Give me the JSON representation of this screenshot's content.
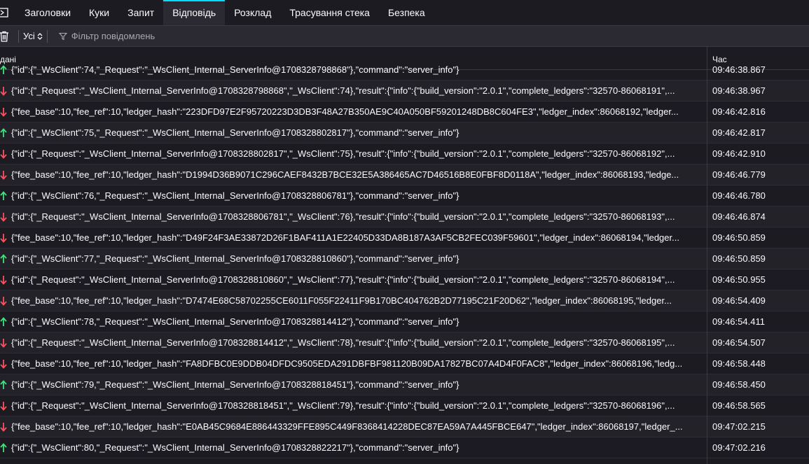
{
  "tabs": [
    {
      "label": "Заголовки",
      "selected": false
    },
    {
      "label": "Куки",
      "selected": false
    },
    {
      "label": "Запит",
      "selected": false
    },
    {
      "label": "Відповідь",
      "selected": true
    },
    {
      "label": "Розклад",
      "selected": false
    },
    {
      "label": "Трасування стека",
      "selected": false
    },
    {
      "label": "Безпека",
      "selected": false
    }
  ],
  "toolbar": {
    "select_value": "Усі",
    "filter_placeholder": "Фільтр повідомлень"
  },
  "columns": {
    "data": "дані",
    "time": "Час"
  },
  "colors": {
    "sent": "#3fe17a",
    "received": "#ff4f5e",
    "accent": "#00ddff"
  },
  "messages": [
    {
      "direction": "sent",
      "text": "{\"id\":{\"_WsClient\":74,\"_Request\":\"_WsClient_Internal_ServerInfo@1708328798868\"},\"command\":\"server_info\"}",
      "time": "09:46:38.867"
    },
    {
      "direction": "received",
      "text": "{\"id\":{\"_Request\":\"_WsClient_Internal_ServerInfo@1708328798868\",\"_WsClient\":74},\"result\":{\"info\":{\"build_version\":\"2.0.1\",\"complete_ledgers\":\"32570-86068191\",...",
      "time": "09:46:38.967"
    },
    {
      "direction": "received",
      "text": "{\"fee_base\":10,\"fee_ref\":10,\"ledger_hash\":\"223DFD97E2F95720223D3DB3F48A27B350AE9C40A050BF59201248DB8C604FE3\",\"ledger_index\":86068192,\"ledger...",
      "time": "09:46:42.816"
    },
    {
      "direction": "sent",
      "text": "{\"id\":{\"_WsClient\":75,\"_Request\":\"_WsClient_Internal_ServerInfo@1708328802817\"},\"command\":\"server_info\"}",
      "time": "09:46:42.817"
    },
    {
      "direction": "received",
      "text": "{\"id\":{\"_Request\":\"_WsClient_Internal_ServerInfo@1708328802817\",\"_WsClient\":75},\"result\":{\"info\":{\"build_version\":\"2.0.1\",\"complete_ledgers\":\"32570-86068192\",...",
      "time": "09:46:42.910"
    },
    {
      "direction": "received",
      "text": "{\"fee_base\":10,\"fee_ref\":10,\"ledger_hash\":\"D1994D36B9071C296CAEF8432B7BCE32E5A386465AC7D46516B8E0FBF8D0118A\",\"ledger_index\":86068193,\"ledge...",
      "time": "09:46:46.779"
    },
    {
      "direction": "sent",
      "text": "{\"id\":{\"_WsClient\":76,\"_Request\":\"_WsClient_Internal_ServerInfo@1708328806781\"},\"command\":\"server_info\"}",
      "time": "09:46:46.780"
    },
    {
      "direction": "received",
      "text": "{\"id\":{\"_Request\":\"_WsClient_Internal_ServerInfo@1708328806781\",\"_WsClient\":76},\"result\":{\"info\":{\"build_version\":\"2.0.1\",\"complete_ledgers\":\"32570-86068193\",...",
      "time": "09:46:46.874"
    },
    {
      "direction": "received",
      "text": "{\"fee_base\":10,\"fee_ref\":10,\"ledger_hash\":\"D49F24F3AE33872D26F1BAF411A1E22405D33DA8B187A3AF5CB2FEC039F59601\",\"ledger_index\":86068194,\"ledger...",
      "time": "09:46:50.859"
    },
    {
      "direction": "sent",
      "text": "{\"id\":{\"_WsClient\":77,\"_Request\":\"_WsClient_Internal_ServerInfo@1708328810860\"},\"command\":\"server_info\"}",
      "time": "09:46:50.859"
    },
    {
      "direction": "received",
      "text": "{\"id\":{\"_Request\":\"_WsClient_Internal_ServerInfo@1708328810860\",\"_WsClient\":77},\"result\":{\"info\":{\"build_version\":\"2.0.1\",\"complete_ledgers\":\"32570-86068194\",...",
      "time": "09:46:50.955"
    },
    {
      "direction": "received",
      "text": "{\"fee_base\":10,\"fee_ref\":10,\"ledger_hash\":\"D7474E68C58702255CE6011F055F22411F9B170BC404762B2D77195C21F20D62\",\"ledger_index\":86068195,\"ledger...",
      "time": "09:46:54.409"
    },
    {
      "direction": "sent",
      "text": "{\"id\":{\"_WsClient\":78,\"_Request\":\"_WsClient_Internal_ServerInfo@1708328814412\"},\"command\":\"server_info\"}",
      "time": "09:46:54.411"
    },
    {
      "direction": "received",
      "text": "{\"id\":{\"_Request\":\"_WsClient_Internal_ServerInfo@1708328814412\",\"_WsClient\":78},\"result\":{\"info\":{\"build_version\":\"2.0.1\",\"complete_ledgers\":\"32570-86068195\",...",
      "time": "09:46:54.507"
    },
    {
      "direction": "received",
      "text": "{\"fee_base\":10,\"fee_ref\":10,\"ledger_hash\":\"FA8DFBC0E9DDB04DFDC9505EDA291DBFBF981120B09DA17827BC07A4D4F0FAC8\",\"ledger_index\":86068196,\"ledg...",
      "time": "09:46:58.448"
    },
    {
      "direction": "sent",
      "text": "{\"id\":{\"_WsClient\":79,\"_Request\":\"_WsClient_Internal_ServerInfo@1708328818451\"},\"command\":\"server_info\"}",
      "time": "09:46:58.450"
    },
    {
      "direction": "received",
      "text": "{\"id\":{\"_Request\":\"_WsClient_Internal_ServerInfo@1708328818451\",\"_WsClient\":79},\"result\":{\"info\":{\"build_version\":\"2.0.1\",\"complete_ledgers\":\"32570-86068196\",...",
      "time": "09:46:58.565"
    },
    {
      "direction": "received",
      "text": "{\"fee_base\":10,\"fee_ref\":10,\"ledger_hash\":\"E0AB45C9684E886443329FFE895C449F8368414228DEC87EA59A7A445FBCE647\",\"ledger_index\":86068197,\"ledger_...",
      "time": "09:47:02.215"
    },
    {
      "direction": "sent",
      "text": "{\"id\":{\"_WsClient\":80,\"_Request\":\"_WsClient_Internal_ServerInfo@1708328822217\"},\"command\":\"server_info\"}",
      "time": "09:47:02.216"
    }
  ]
}
